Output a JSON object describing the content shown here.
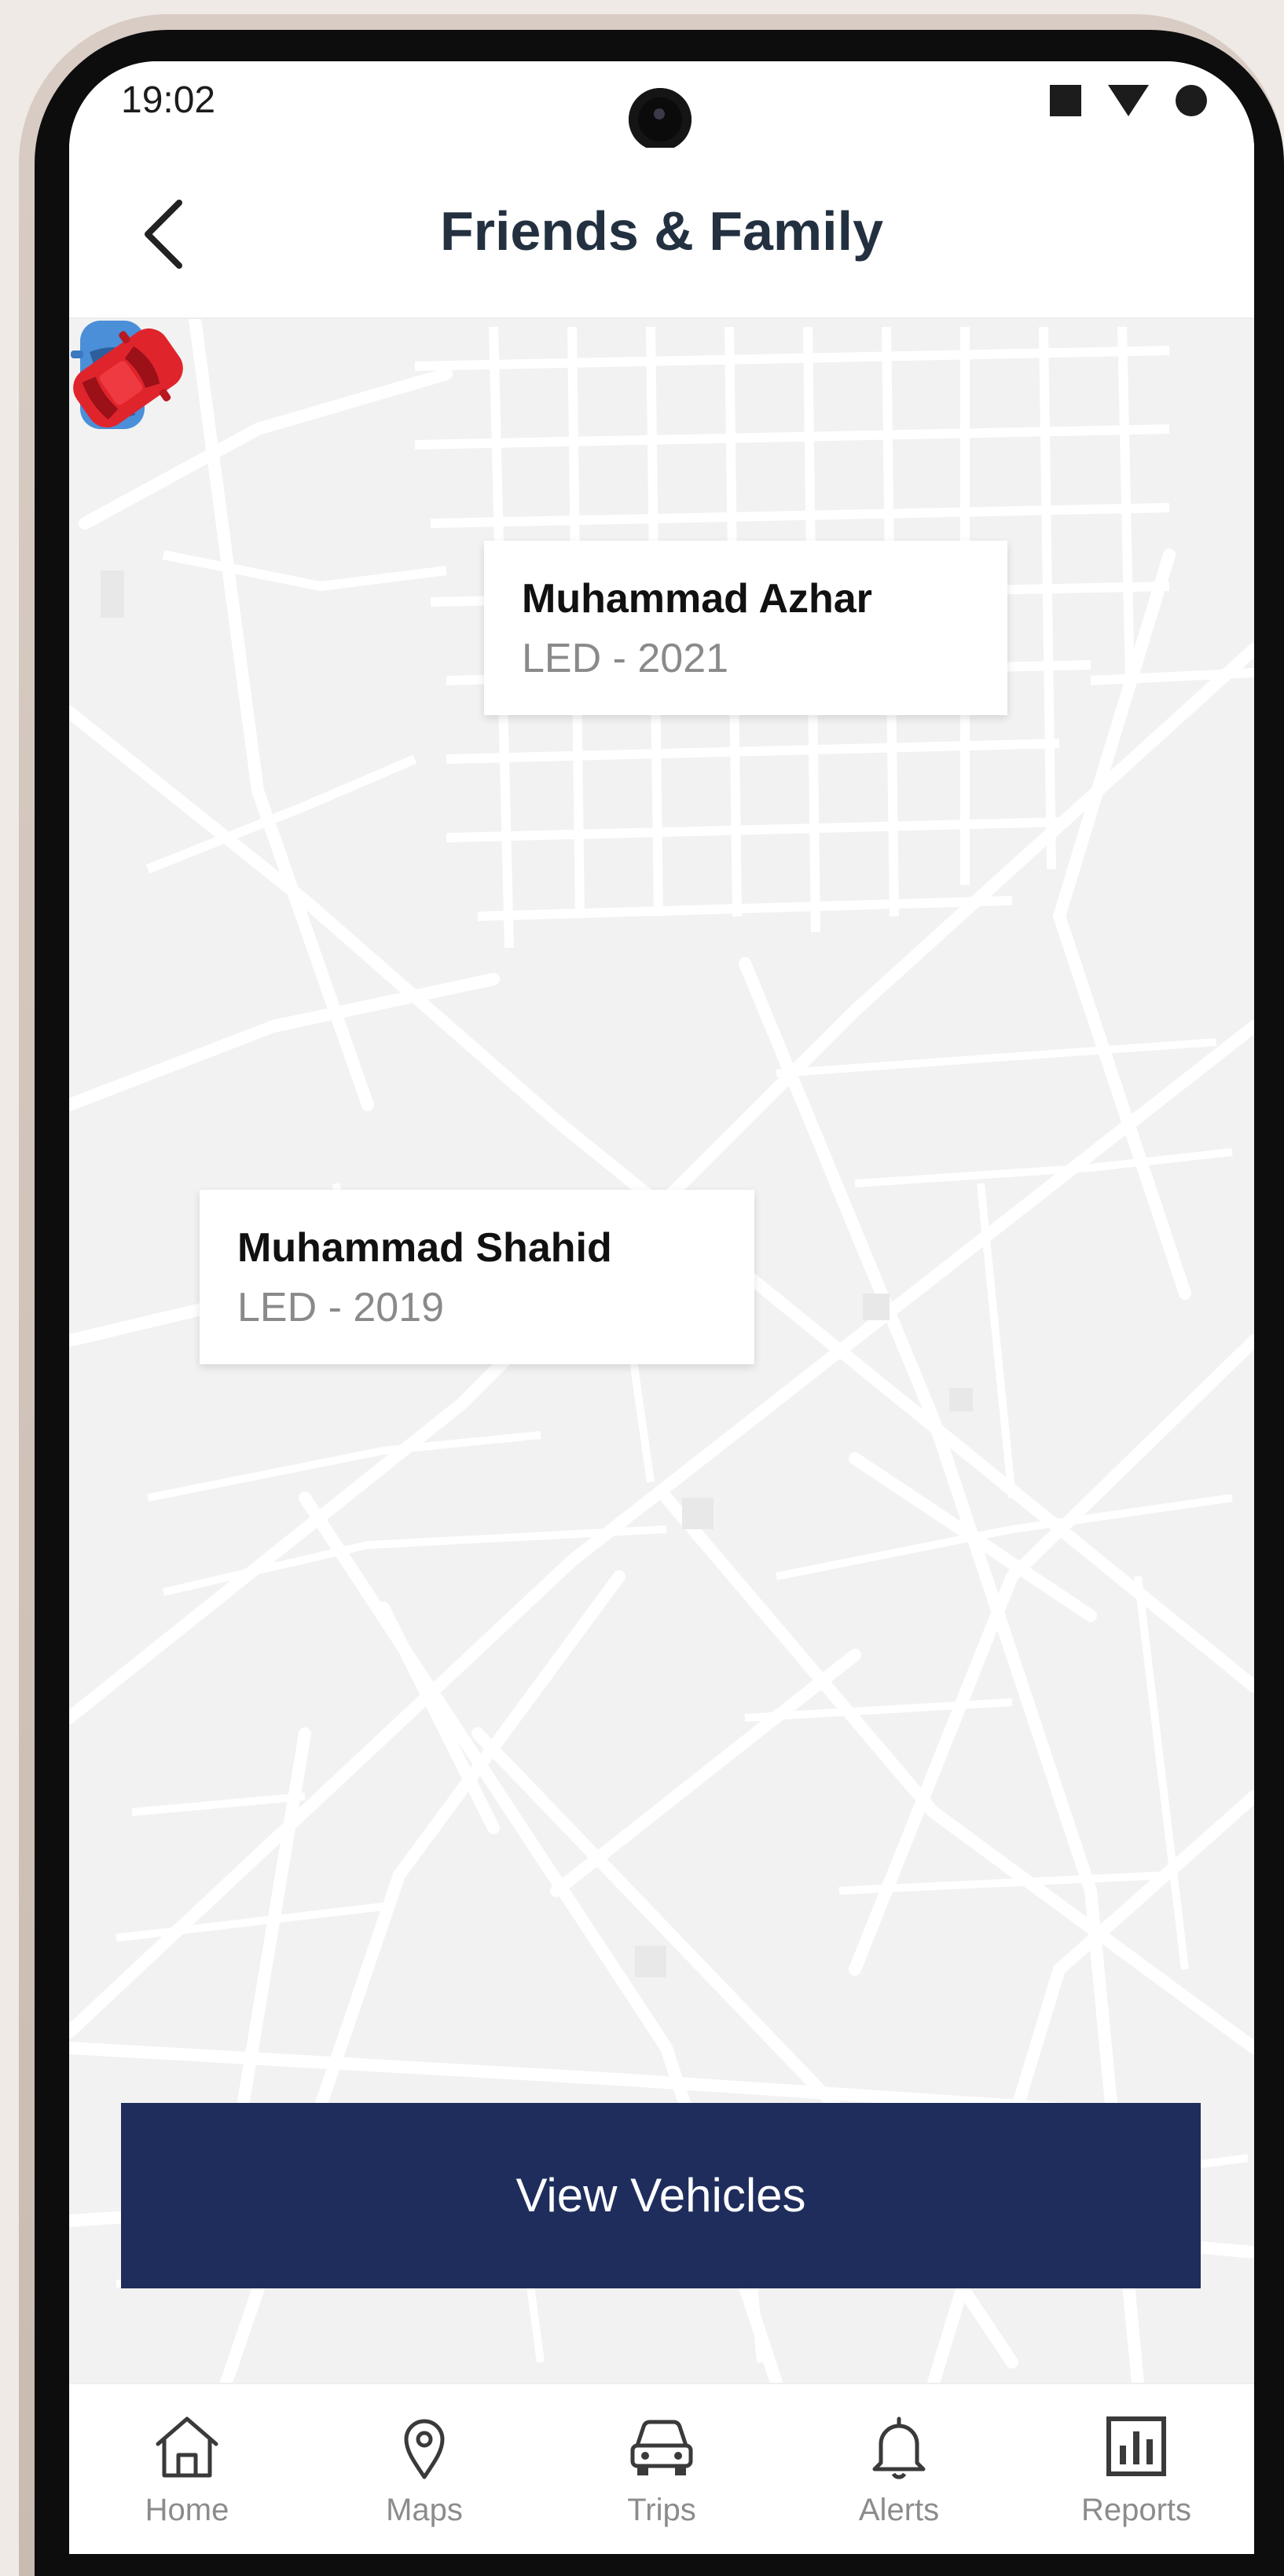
{
  "status_bar": {
    "time": "19:02",
    "icons": [
      "stop-icon",
      "wifi-icon",
      "dot-icon"
    ]
  },
  "header": {
    "title": "Friends & Family",
    "back_icon": "chevron-left-icon"
  },
  "map": {
    "pins": [
      {
        "name": "Muhammad Azhar",
        "vehicle": "LED - 2021",
        "car_color": "#4a8fd8"
      },
      {
        "name": "Muhammad Shahid",
        "vehicle": "LED - 2019",
        "car_color": "#e0242c"
      }
    ]
  },
  "actions": {
    "view_vehicles_label": "View Vehicles",
    "button_color": "#1e2d5c"
  },
  "bottom_nav": {
    "items": [
      {
        "label": "Home",
        "icon": "home-icon"
      },
      {
        "label": "Maps",
        "icon": "map-pin-icon"
      },
      {
        "label": "Trips",
        "icon": "car-icon"
      },
      {
        "label": "Alerts",
        "icon": "bell-icon"
      },
      {
        "label": "Reports",
        "icon": "bar-chart-icon"
      }
    ]
  }
}
